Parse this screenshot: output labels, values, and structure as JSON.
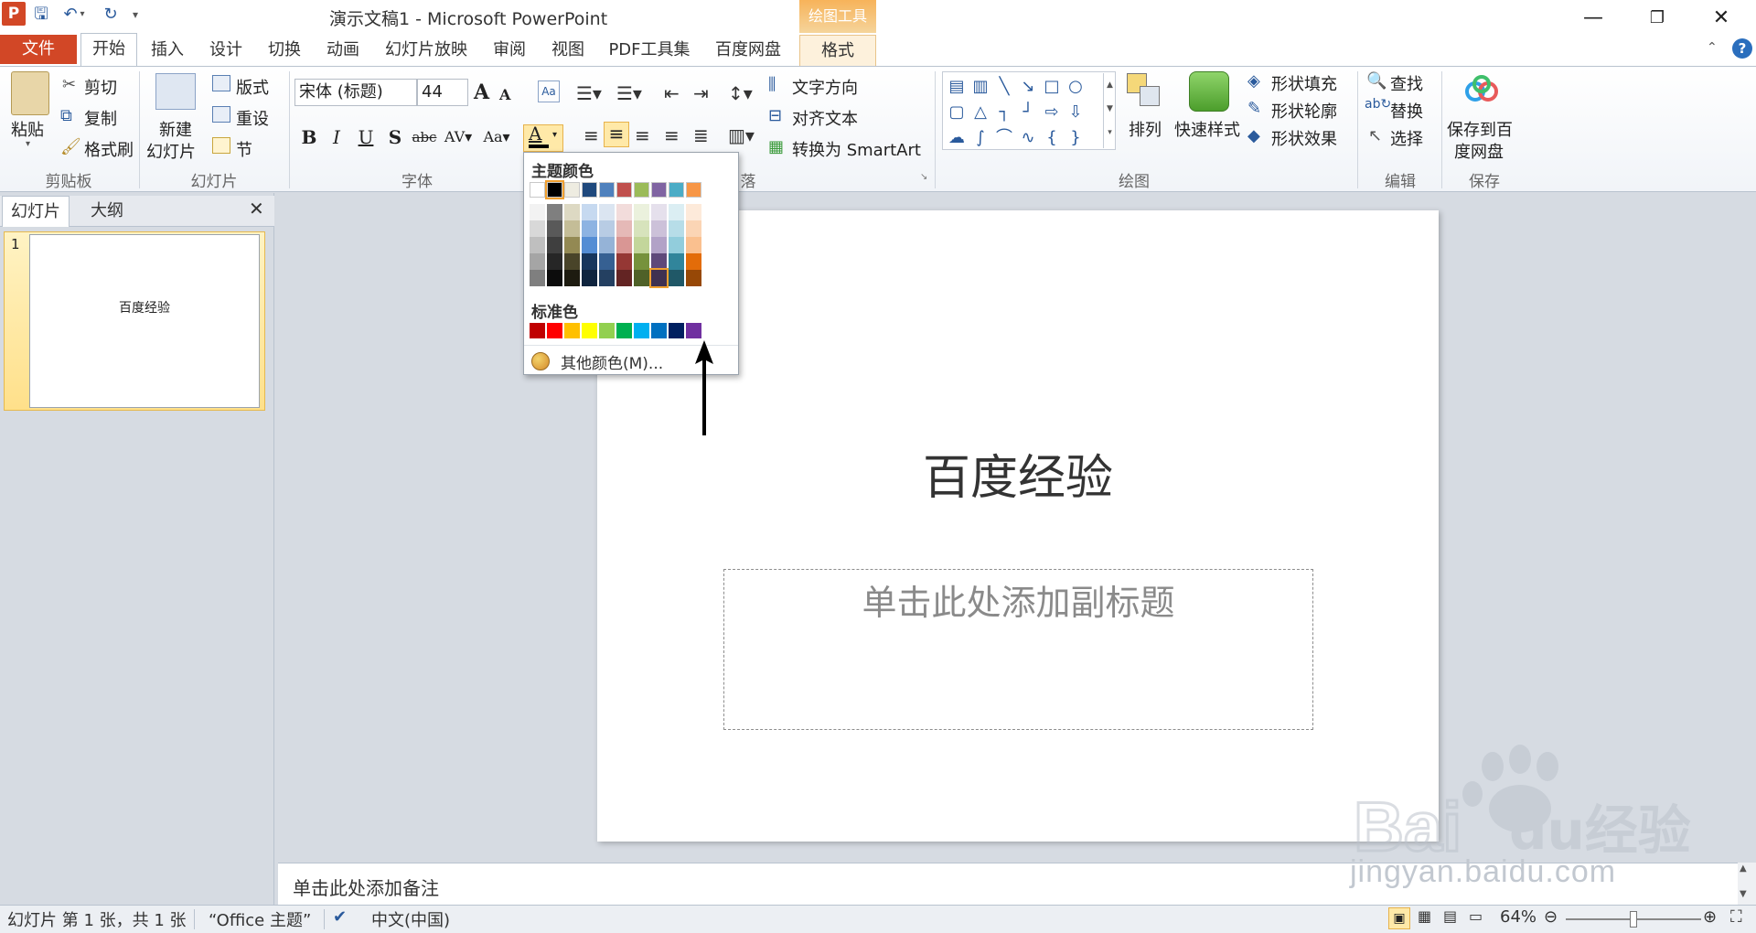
{
  "window": {
    "title": "演示文稿1 - Microsoft PowerPoint",
    "tools_group": "绘图工具"
  },
  "tabs": [
    "文件",
    "开始",
    "插入",
    "设计",
    "切换",
    "动画",
    "幻灯片放映",
    "审阅",
    "视图",
    "PDF工具集",
    "百度网盘",
    "格式"
  ],
  "ribbon": {
    "clipboard": {
      "paste": "粘贴",
      "cut": "剪切",
      "copy": "复制",
      "format_painter": "格式刷",
      "label": "剪贴板"
    },
    "slides": {
      "new_slide_line1": "新建",
      "new_slide_line2": "幻灯片",
      "layout": "版式",
      "reset": "重设",
      "section": "节",
      "label": "幻灯片"
    },
    "font": {
      "name": "宋体 (标题)",
      "size": "44",
      "label": "字体"
    },
    "paragraph": {
      "text_direction": "文字方向",
      "align_text": "对齐文本",
      "convert_smartart": "转换为 SmartArt",
      "label_partial": "落"
    },
    "drawing": {
      "arrange": "排列",
      "quick_styles": "快速样式",
      "shape_fill": "形状填充",
      "shape_outline": "形状轮廓",
      "shape_effects": "形状效果",
      "label": "绘图"
    },
    "editing": {
      "find": "查找",
      "replace": "替换",
      "select": "选择",
      "label": "编辑"
    },
    "save": {
      "line1": "保存到百",
      "line2": "度网盘",
      "label": "保存"
    }
  },
  "color_popup": {
    "theme_header": "主题颜色",
    "standard_header": "标准色",
    "more_colors": "其他颜色(M)...",
    "theme_top": [
      "#ffffff",
      "#000000",
      "#eeece1",
      "#1f497d",
      "#4f81bd",
      "#c0504d",
      "#9bbb59",
      "#8064a2",
      "#4bacc6",
      "#f79646"
    ],
    "theme_shades": [
      [
        "#f2f2f2",
        "#7f7f7f",
        "#ddd9c3",
        "#c6d9f0",
        "#dbe5f1",
        "#f2dcdb",
        "#ebf1dd",
        "#e5e0ec",
        "#dbeef3",
        "#fdeada"
      ],
      [
        "#d8d8d8",
        "#595959",
        "#c4bd97",
        "#8db3e2",
        "#b8cce4",
        "#e5b9b7",
        "#d7e3bc",
        "#ccc1d9",
        "#b7dde8",
        "#fbd5b5"
      ],
      [
        "#bfbfbf",
        "#3f3f3f",
        "#938953",
        "#548dd4",
        "#95b3d7",
        "#d99694",
        "#c3d69b",
        "#b2a2c7",
        "#92cddc",
        "#fac08f"
      ],
      [
        "#a5a5a5",
        "#262626",
        "#494429",
        "#17365d",
        "#366092",
        "#953734",
        "#76923c",
        "#5f497a",
        "#31859b",
        "#e36c09"
      ],
      [
        "#7f7f7f",
        "#0c0c0c",
        "#1d1b10",
        "#0f243e",
        "#244061",
        "#632423",
        "#4f6128",
        "#3f3151",
        "#205867",
        "#974806"
      ]
    ],
    "standard": [
      "#c00000",
      "#ff0000",
      "#ffc000",
      "#ffff00",
      "#92d050",
      "#00b050",
      "#00b0f0",
      "#0070c0",
      "#002060",
      "#7030a0"
    ]
  },
  "panes": {
    "slides_tab": "幻灯片",
    "outline_tab": "大纲",
    "slide_number": "1",
    "thumb_title": "百度经验"
  },
  "slide": {
    "title": "百度经验",
    "subtitle_placeholder": "单击此处添加副标题"
  },
  "notes": {
    "placeholder": "单击此处添加备注"
  },
  "status": {
    "slide_info": "幻灯片 第 1 张，共 1 张",
    "theme": "“Office 主题”",
    "language": "中文(中国)",
    "zoom": "64%"
  },
  "watermark": {
    "brand": "Bai经验",
    "url": "jingyan.baidu.com"
  }
}
